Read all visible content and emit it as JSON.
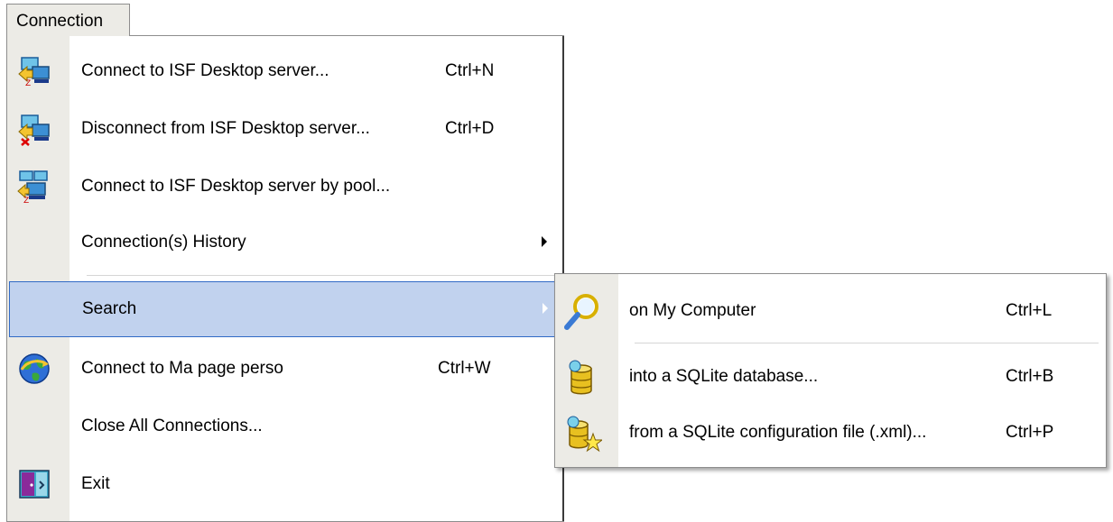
{
  "menubar": {
    "title": "Connection"
  },
  "menu": {
    "items": [
      {
        "label": "Connect to ISF Desktop server...",
        "shortcut": "Ctrl+N",
        "icon": "network-connect-icon"
      },
      {
        "label": "Disconnect from ISF Desktop server...",
        "shortcut": "Ctrl+D",
        "icon": "network-disconnect-icon"
      },
      {
        "label": "Connect to ISF Desktop server by pool...",
        "shortcut": "",
        "icon": "network-pool-icon"
      },
      {
        "label": "Connection(s) History",
        "shortcut": "",
        "submenu": true
      },
      {
        "label": "Search",
        "shortcut": "",
        "submenu": true,
        "selected": true
      },
      {
        "label": "Connect to Ma page perso",
        "shortcut": "Ctrl+W",
        "icon": "globe-icon"
      },
      {
        "label": "Close All Connections...",
        "shortcut": ""
      },
      {
        "label": "Exit",
        "shortcut": "",
        "icon": "exit-door-icon"
      }
    ]
  },
  "submenu": {
    "items": [
      {
        "label": "on My Computer",
        "shortcut": "Ctrl+L",
        "icon": "magnifier-icon"
      },
      {
        "label": "into a SQLite database...",
        "shortcut": "Ctrl+B",
        "icon": "database-icon"
      },
      {
        "label": "from a SQLite configuration file (.xml)...",
        "shortcut": "Ctrl+P",
        "icon": "database-star-icon"
      }
    ]
  },
  "colors": {
    "gutter": "#ecebe6",
    "selected_bg": "#c1d2ee",
    "selected_border": "#316ac5"
  }
}
